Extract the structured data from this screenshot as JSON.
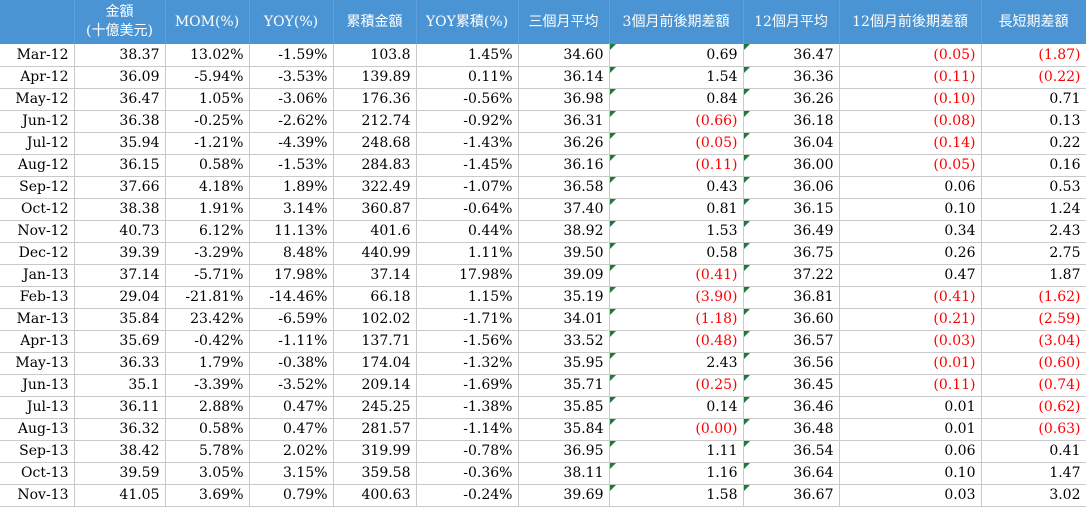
{
  "columns": [
    {
      "line1": "",
      "line2": ""
    },
    {
      "line1": "金額",
      "line2": "(十億美元)"
    },
    {
      "line1": "MOM(%)",
      "line2": ""
    },
    {
      "line1": "YOY(%)",
      "line2": ""
    },
    {
      "line1": "累積金額",
      "line2": ""
    },
    {
      "line1": "YOY累積(%)",
      "line2": ""
    },
    {
      "line1": "三個月平均",
      "line2": ""
    },
    {
      "line1": "3個月前後期差額",
      "line2": ""
    },
    {
      "line1": "12個月平均",
      "line2": ""
    },
    {
      "line1": "12個月前後期差額",
      "line2": ""
    },
    {
      "line1": "長短期差額",
      "line2": ""
    }
  ],
  "rows": [
    [
      "Mar-12",
      "38.37",
      "13.02%",
      "-1.59%",
      "103.8",
      "1.45%",
      "34.60",
      "0.69",
      "36.47",
      "(0.05)",
      "(1.87)"
    ],
    [
      "Apr-12",
      "36.09",
      "-5.94%",
      "-3.53%",
      "139.89",
      "0.11%",
      "36.14",
      "1.54",
      "36.36",
      "(0.11)",
      "(0.22)"
    ],
    [
      "May-12",
      "36.47",
      "1.05%",
      "-3.06%",
      "176.36",
      "-0.56%",
      "36.98",
      "0.84",
      "36.26",
      "(0.10)",
      "0.71"
    ],
    [
      "Jun-12",
      "36.38",
      "-0.25%",
      "-2.62%",
      "212.74",
      "-0.92%",
      "36.31",
      "(0.66)",
      "36.18",
      "(0.08)",
      "0.13"
    ],
    [
      "Jul-12",
      "35.94",
      "-1.21%",
      "-4.39%",
      "248.68",
      "-1.43%",
      "36.26",
      "(0.05)",
      "36.04",
      "(0.14)",
      "0.22"
    ],
    [
      "Aug-12",
      "36.15",
      "0.58%",
      "-1.53%",
      "284.83",
      "-1.45%",
      "36.16",
      "(0.11)",
      "36.00",
      "(0.05)",
      "0.16"
    ],
    [
      "Sep-12",
      "37.66",
      "4.18%",
      "1.89%",
      "322.49",
      "-1.07%",
      "36.58",
      "0.43",
      "36.06",
      "0.06",
      "0.53"
    ],
    [
      "Oct-12",
      "38.38",
      "1.91%",
      "3.14%",
      "360.87",
      "-0.64%",
      "37.40",
      "0.81",
      "36.15",
      "0.10",
      "1.24"
    ],
    [
      "Nov-12",
      "40.73",
      "6.12%",
      "11.13%",
      "401.6",
      "0.44%",
      "38.92",
      "1.53",
      "36.49",
      "0.34",
      "2.43"
    ],
    [
      "Dec-12",
      "39.39",
      "-3.29%",
      "8.48%",
      "440.99",
      "1.11%",
      "39.50",
      "0.58",
      "36.75",
      "0.26",
      "2.75"
    ],
    [
      "Jan-13",
      "37.14",
      "-5.71%",
      "17.98%",
      "37.14",
      "17.98%",
      "39.09",
      "(0.41)",
      "37.22",
      "0.47",
      "1.87"
    ],
    [
      "Feb-13",
      "29.04",
      "-21.81%",
      "-14.46%",
      "66.18",
      "1.15%",
      "35.19",
      "(3.90)",
      "36.81",
      "(0.41)",
      "(1.62)"
    ],
    [
      "Mar-13",
      "35.84",
      "23.42%",
      "-6.59%",
      "102.02",
      "-1.71%",
      "34.01",
      "(1.18)",
      "36.60",
      "(0.21)",
      "(2.59)"
    ],
    [
      "Apr-13",
      "35.69",
      "-0.42%",
      "-1.11%",
      "137.71",
      "-1.56%",
      "33.52",
      "(0.48)",
      "36.57",
      "(0.03)",
      "(3.04)"
    ],
    [
      "May-13",
      "36.33",
      "1.79%",
      "-0.38%",
      "174.04",
      "-1.32%",
      "35.95",
      "2.43",
      "36.56",
      "(0.01)",
      "(0.60)"
    ],
    [
      "Jun-13",
      "35.1",
      "-3.39%",
      "-3.52%",
      "209.14",
      "-1.69%",
      "35.71",
      "(0.25)",
      "36.45",
      "(0.11)",
      "(0.74)"
    ],
    [
      "Jul-13",
      "36.11",
      "2.88%",
      "0.47%",
      "245.25",
      "-1.38%",
      "35.85",
      "0.14",
      "36.46",
      "0.01",
      "(0.62)"
    ],
    [
      "Aug-13",
      "36.32",
      "0.58%",
      "0.47%",
      "281.57",
      "-1.14%",
      "35.84",
      "(0.00)",
      "36.48",
      "0.01",
      "(0.63)"
    ],
    [
      "Sep-13",
      "38.42",
      "5.78%",
      "2.02%",
      "319.99",
      "-0.78%",
      "36.95",
      "1.11",
      "36.54",
      "0.06",
      "0.41"
    ],
    [
      "Oct-13",
      "39.59",
      "3.05%",
      "3.15%",
      "359.58",
      "-0.36%",
      "38.11",
      "1.16",
      "36.64",
      "0.10",
      "1.47"
    ],
    [
      "Nov-13",
      "41.05",
      "3.69%",
      "0.79%",
      "400.63",
      "-0.24%",
      "39.69",
      "1.58",
      "36.67",
      "0.03",
      "3.02"
    ]
  ],
  "flagged_columns": [
    7,
    8
  ],
  "negative_color": "#ff0000",
  "header_color": "#4b94d4"
}
